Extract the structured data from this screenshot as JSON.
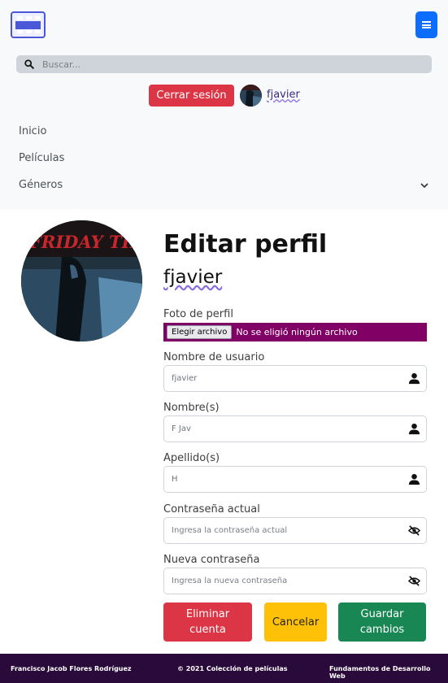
{
  "nav": {
    "logo_icon": "film-strip-logo-icon",
    "menu_icon": "hamburger-menu-icon",
    "search": {
      "placeholder": "Buscar...",
      "icon": "search-icon"
    },
    "logout_label": "Cerrar sesión",
    "username": "fjavier",
    "items": [
      {
        "label": "Inicio"
      },
      {
        "label": "Películas"
      },
      {
        "label": "Géneros",
        "icon": "chevron-down-icon"
      }
    ]
  },
  "profile": {
    "title": "Editar perfil",
    "username": "fjavier",
    "photo_label": "Foto de perfil",
    "file_button": "Elegir archivo",
    "file_status": "No se eligió ningún archivo",
    "fields": [
      {
        "label": "Nombre de usuario",
        "value": "fjavier",
        "placeholder": "",
        "icon": "user-icon"
      },
      {
        "label": "Nombre(s)",
        "value": "F Jav",
        "placeholder": "",
        "icon": "user-icon"
      },
      {
        "label": "Apellido(s)",
        "value": "H",
        "placeholder": "",
        "icon": "user-icon"
      },
      {
        "label": "Contraseña actual",
        "value": "",
        "placeholder": "Ingresa la contraseña actual",
        "icon": "eye-slash-icon"
      },
      {
        "label": "Nueva contraseña",
        "value": "",
        "placeholder": "Ingresa la nueva contraseña",
        "icon": "eye-slash-icon"
      }
    ],
    "buttons": {
      "delete": "Eliminar cuenta",
      "cancel": "Cancelar",
      "save": "Guardar cambios"
    }
  },
  "footer": {
    "author": "Francisco Jacob Flores Rodríguez",
    "copyright": "© 2021 Colección de películas",
    "course": "Fundamentos de Desarrollo Web"
  },
  "colors": {
    "accent": "#0d6efd",
    "danger": "#dc3545",
    "warning": "#ffc107",
    "success": "#198754",
    "file_bar": "#800066",
    "footer_bg": "#2a0a3a"
  }
}
